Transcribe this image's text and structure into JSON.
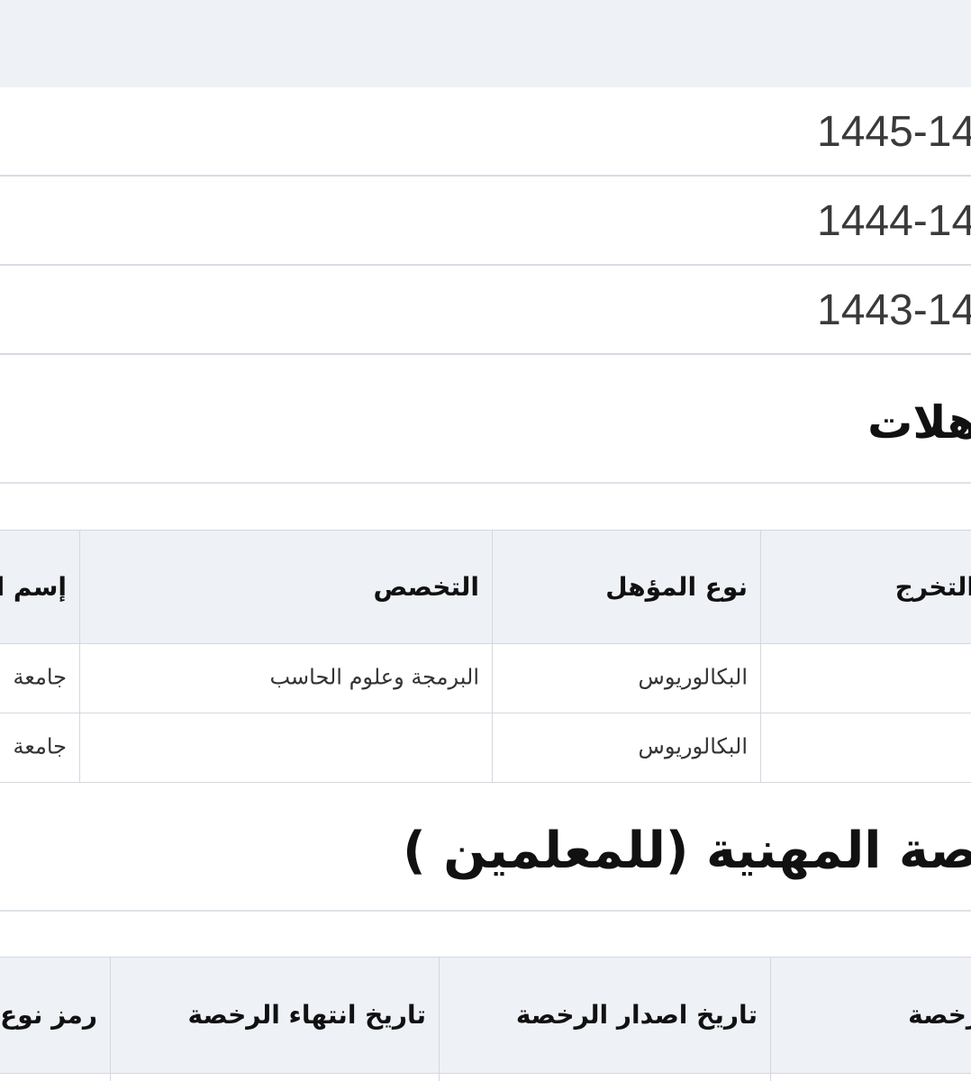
{
  "years_table": {
    "rows": [
      "1445-14",
      "1444-14",
      "1443-14"
    ]
  },
  "qualifications": {
    "title": "هلات",
    "headers": {
      "graduation": "التخرج",
      "qualification_type": "نوع المؤهل",
      "specialization": "التخصص",
      "institution_name": "إسم ا"
    },
    "rows": [
      {
        "graduation": "",
        "qualification_type": "البكالوريوس",
        "specialization": "البرمجة وعلوم الحاسب",
        "institution_name": "جامعة"
      },
      {
        "graduation": "",
        "qualification_type": "البكالوريوس",
        "specialization": "",
        "institution_name": "جامعة"
      }
    ]
  },
  "license": {
    "title": "صة المهنية (للمعلمين )",
    "headers": {
      "license": "رخصة",
      "issue_date": "تاريخ اصدار الرخصة",
      "expiry_date": "تاريخ انتهاء الرخصة",
      "type_code": "رمز نوع"
    }
  }
}
